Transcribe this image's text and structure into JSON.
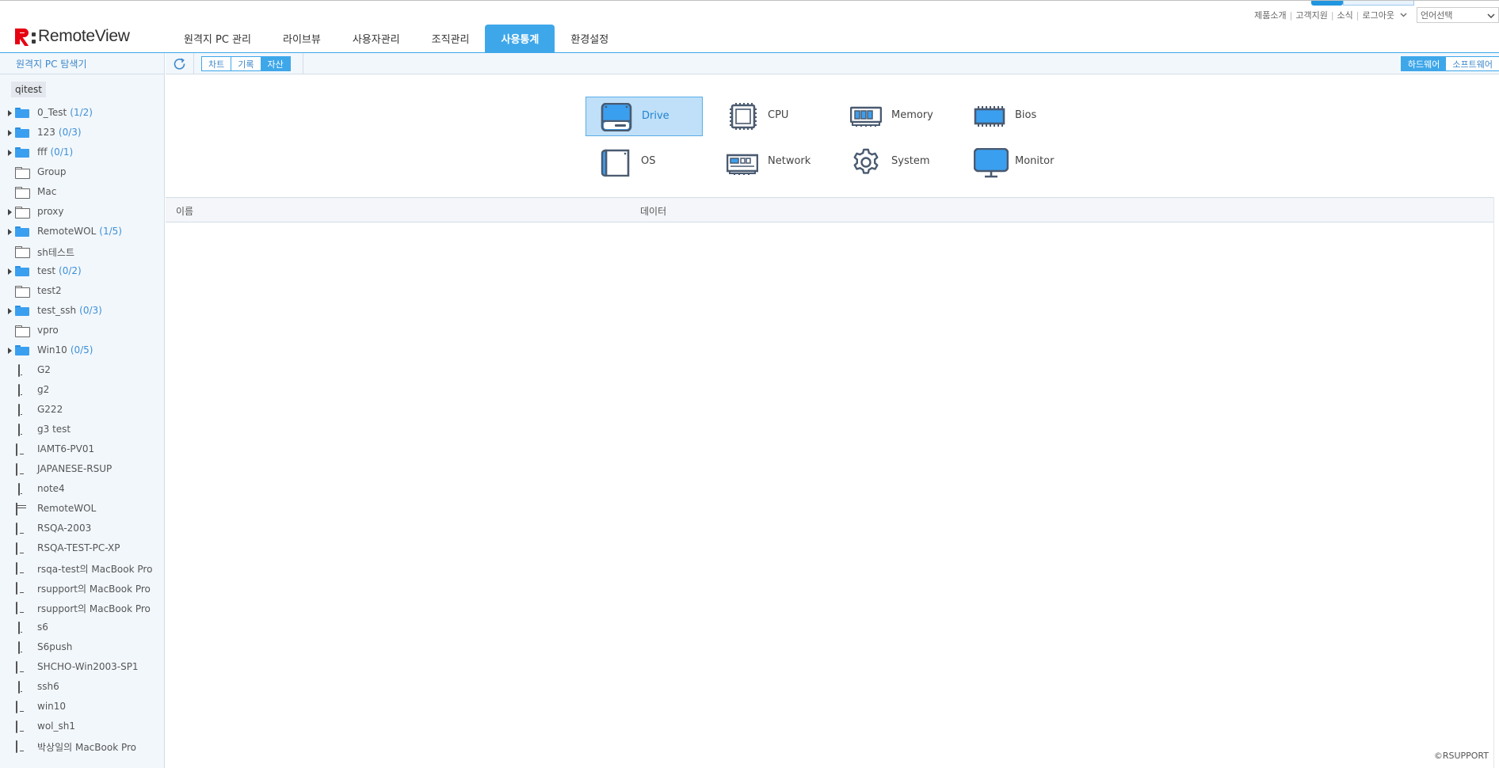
{
  "util_links": [
    "제품소개",
    "고객지원",
    "소식",
    "로그아웃"
  ],
  "language_select": {
    "value": "언어선택"
  },
  "logo": {
    "text": "RemoteView"
  },
  "nav": {
    "tabs": [
      {
        "label": "원격지 PC 관리",
        "active": false
      },
      {
        "label": "라이브뷰",
        "active": false
      },
      {
        "label": "사용자관리",
        "active": false
      },
      {
        "label": "조직관리",
        "active": false
      },
      {
        "label": "사용통계",
        "active": true
      },
      {
        "label": "환경설정",
        "active": false
      }
    ]
  },
  "sidebar": {
    "header": "원격지 PC 탐색기",
    "root": "qitest",
    "items": [
      {
        "label": "0_Test",
        "count": "(1/2)",
        "icon": "folder-filled-icon",
        "expandable": true
      },
      {
        "label": "123",
        "count": "(0/3)",
        "icon": "folder-filled-icon",
        "expandable": true
      },
      {
        "label": "fff",
        "count": "(0/1)",
        "icon": "folder-filled-icon",
        "expandable": true
      },
      {
        "label": "Group",
        "count": "",
        "icon": "folder-empty-icon",
        "expandable": false
      },
      {
        "label": "Mac",
        "count": "",
        "icon": "folder-empty-icon",
        "expandable": false
      },
      {
        "label": "proxy",
        "count": "",
        "icon": "folder-empty-icon",
        "expandable": true
      },
      {
        "label": "RemoteWOL",
        "count": "(1/5)",
        "icon": "folder-filled-icon",
        "expandable": true
      },
      {
        "label": "sh테스트",
        "count": "",
        "icon": "folder-empty-icon",
        "expandable": false
      },
      {
        "label": "test",
        "count": "(0/2)",
        "icon": "folder-filled-icon",
        "expandable": true
      },
      {
        "label": "test2",
        "count": "",
        "icon": "folder-empty-icon",
        "expandable": false
      },
      {
        "label": "test_ssh",
        "count": "(0/3)",
        "icon": "folder-filled-icon",
        "expandable": true
      },
      {
        "label": "vpro",
        "count": "",
        "icon": "folder-empty-icon",
        "expandable": false
      },
      {
        "label": "Win10",
        "count": "(0/5)",
        "icon": "folder-filled-icon",
        "expandable": true
      },
      {
        "label": "G2",
        "count": "",
        "icon": "mobile-device-icon",
        "expandable": false
      },
      {
        "label": "g2",
        "count": "",
        "icon": "mobile-device-icon",
        "expandable": false
      },
      {
        "label": "G222",
        "count": "",
        "icon": "mobile-device-icon",
        "expandable": false
      },
      {
        "label": "g3 test",
        "count": "",
        "icon": "mobile-device-icon",
        "expandable": false
      },
      {
        "label": "IAMT6-PV01",
        "count": "",
        "icon": "monitor-pc-icon",
        "expandable": false
      },
      {
        "label": "JAPANESE-RSUP",
        "count": "",
        "icon": "monitor-pc-icon",
        "expandable": false
      },
      {
        "label": "note4",
        "count": "",
        "icon": "mobile-device-icon",
        "expandable": false
      },
      {
        "label": "RemoteWOL",
        "count": "",
        "icon": "server-icon",
        "expandable": false
      },
      {
        "label": "RSQA-2003",
        "count": "",
        "icon": "monitor-pc-icon",
        "expandable": false
      },
      {
        "label": "RSQA-TEST-PC-XP",
        "count": "",
        "icon": "monitor-pc-icon",
        "expandable": false
      },
      {
        "label": "rsqa-test의 MacBook Pro",
        "count": "",
        "icon": "monitor-pc-icon",
        "expandable": false
      },
      {
        "label": "rsupport의 MacBook Pro",
        "count": "",
        "icon": "monitor-pc-icon",
        "expandable": false
      },
      {
        "label": "rsupport의 MacBook Pro",
        "count": "",
        "icon": "monitor-pc-icon",
        "expandable": false
      },
      {
        "label": "s6",
        "count": "",
        "icon": "mobile-device-icon",
        "expandable": false
      },
      {
        "label": "S6push",
        "count": "",
        "icon": "mobile-device-icon",
        "expandable": false
      },
      {
        "label": "SHCHO-Win2003-SP1",
        "count": "",
        "icon": "monitor-pc-icon",
        "expandable": false
      },
      {
        "label": "ssh6",
        "count": "",
        "icon": "mobile-device-icon",
        "expandable": false
      },
      {
        "label": "win10",
        "count": "",
        "icon": "monitor-pc-icon",
        "expandable": false
      },
      {
        "label": "wol_sh1",
        "count": "",
        "icon": "monitor-pc-icon",
        "expandable": false
      },
      {
        "label": "박상일의 MacBook Pro",
        "count": "",
        "icon": "monitor-pc-icon",
        "expandable": false
      }
    ]
  },
  "toolbar": {
    "refresh_icon": "refresh-icon",
    "view_tabs": [
      {
        "label": "차트",
        "active": false
      },
      {
        "label": "기록",
        "active": false
      },
      {
        "label": "자산",
        "active": true
      }
    ],
    "type_tabs": [
      {
        "label": "하드웨어",
        "active": true
      },
      {
        "label": "소프트웨어",
        "active": false
      }
    ]
  },
  "categories": [
    {
      "label": "Drive",
      "icon": "drive-icon",
      "selected": true
    },
    {
      "label": "CPU",
      "icon": "cpu-icon",
      "selected": false
    },
    {
      "label": "Memory",
      "icon": "memory-icon",
      "selected": false
    },
    {
      "label": "Bios",
      "icon": "bios-icon",
      "selected": false
    },
    {
      "label": "OS",
      "icon": "os-icon",
      "selected": false
    },
    {
      "label": "Network",
      "icon": "network-icon",
      "selected": false
    },
    {
      "label": "System",
      "icon": "gear-icon",
      "selected": false
    },
    {
      "label": "Monitor",
      "icon": "monitor-icon",
      "selected": false
    }
  ],
  "grid": {
    "columns": [
      "이름",
      "데이터"
    ],
    "rows": []
  },
  "copyright": "©RSUPPORT",
  "colors": {
    "accent": "#3ea7ea",
    "brand": "#e60012",
    "count": "#3d8fd6"
  }
}
